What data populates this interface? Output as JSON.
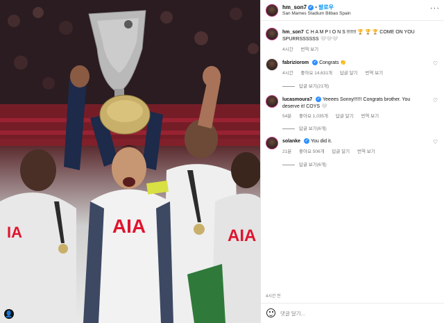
{
  "post": {
    "username": "hm_son7",
    "follow_label": "팔로우",
    "location": "San Mames Stadium Bilbao Spain",
    "time_ago": "4시간 전",
    "more_icon": "more-horizontal-icon"
  },
  "caption": {
    "username": "hm_son7",
    "text": "C H A M P I O N S !!!!!!! 🏆 🏆 🏆 COME ON YOU SPURRSSSSSS 🤍🤍🤍",
    "time": "4시간",
    "translate_label": "번역 보기"
  },
  "comments": [
    {
      "username": "fabriziorom",
      "verified": true,
      "text": "Congrats 👏",
      "time": "4시간",
      "likes": "좋아요 14,631개",
      "reply_label": "답글 달기",
      "translate_label": "번역 보기",
      "replies_label": "답글 보기(21개)"
    },
    {
      "username": "lucasmoura7",
      "verified": true,
      "text": "Yeeees Sonny!!!!!! Congrats brother. You deserve it! COYS 🤍",
      "time": "54분",
      "likes": "좋아요 1,035개",
      "reply_label": "답글 달기",
      "translate_label": "번역 보기",
      "replies_label": "답글 보기(6개)"
    },
    {
      "username": "solanke",
      "verified": true,
      "text": "You did it.",
      "time": "21분",
      "likes": "좋아요 506개",
      "reply_label": "답글 달기",
      "translate_label": "번역 보기",
      "replies_label": "답글 보기(6개)"
    }
  ],
  "footer": {
    "time": "4시간 전"
  },
  "comment_box": {
    "placeholder": "댓글 달기..."
  },
  "photo": {
    "jersey_text": "AIA",
    "accent_primary": "#e0142e",
    "kit_color": "#f2f2f2",
    "trophy_color": "#b7b7b7"
  }
}
